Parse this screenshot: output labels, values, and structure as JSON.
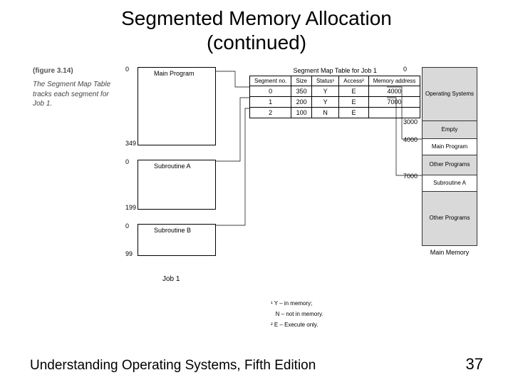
{
  "title": "Segmented Memory Allocation",
  "subtitle": "(continued)",
  "figure_ref": "(figure 3.14)",
  "caption_line1": "The Segment Map Table",
  "caption_line2": "tracks each segment for",
  "caption_line3": "Job 1.",
  "job": {
    "main_label": "Main Program",
    "main_start": "0",
    "main_end": "349",
    "suba_label": "Subroutine A",
    "suba_start": "0",
    "suba_end": "199",
    "subb_label": "Subroutine B",
    "subb_start": "0",
    "subb_end": "99",
    "label": "Job 1"
  },
  "smt": {
    "title": "Segment Map Table for Job 1",
    "headers": {
      "seg": "Segment no.",
      "size": "Size",
      "status": "Status¹",
      "access": "Access²",
      "addr": "Memory address"
    },
    "rows": [
      {
        "seg": "0",
        "size": "350",
        "status": "Y",
        "access": "E",
        "addr": "4000"
      },
      {
        "seg": "1",
        "size": "200",
        "status": "Y",
        "access": "E",
        "addr": "7000"
      },
      {
        "seg": "2",
        "size": "100",
        "status": "N",
        "access": "E",
        "addr": ""
      }
    ]
  },
  "memory": {
    "scale0": "0",
    "scale_3000": "3000",
    "scale_4000": "4000",
    "scale_7000": "7000",
    "os": "Operating Systems",
    "empty": "Empty",
    "main": "Main Program",
    "other1": "Other Programs",
    "suba": "Subroutine A",
    "other2": "Other Programs",
    "title": "Main Memory"
  },
  "footnotes": {
    "f1a": "¹ Y – in memory;",
    "f1b": "   N – not in memory.",
    "f2": "² E – Execute only."
  },
  "footer": "Understanding Operating Systems, Fifth Edition",
  "pagenum": "37"
}
